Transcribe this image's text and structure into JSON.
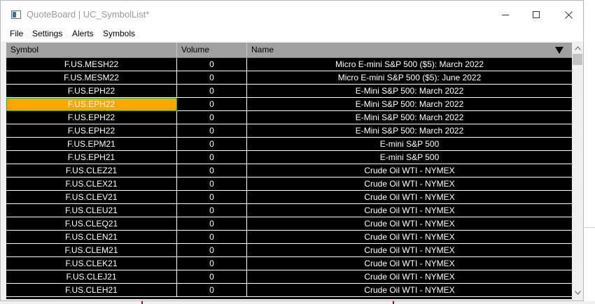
{
  "window": {
    "title": "QuoteBoard | UC_SymbolList*",
    "app_icon": "window-app-icon",
    "controls": [
      "minimize-icon",
      "maximize-icon",
      "close-icon"
    ]
  },
  "menu": {
    "items": [
      {
        "label": "File"
      },
      {
        "label": "Settings"
      },
      {
        "label": "Alerts"
      },
      {
        "label": "Symbols"
      }
    ]
  },
  "grid": {
    "columns": [
      {
        "label": "Symbol"
      },
      {
        "label": "Volume"
      },
      {
        "label": "Name"
      }
    ],
    "sort_icon": "sort-down-triangle-icon",
    "colors": {
      "background": "#000000",
      "text": "#ffffff",
      "header": "#a0a0a0",
      "selected": "#ffa500"
    },
    "selected_row": 3,
    "rows": [
      {
        "symbol": "F.US.MESH22",
        "volume": "0",
        "name": "Micro E-mini S&P 500 ($5): March 2022"
      },
      {
        "symbol": "F.US.MESM22",
        "volume": "0",
        "name": "Micro E-mini S&P 500 ($5): June 2022"
      },
      {
        "symbol": "F.US.EPH22",
        "volume": "0",
        "name": "E-Mini S&P 500: March 2022"
      },
      {
        "symbol": "F.US.EPH22",
        "volume": "0",
        "name": "E-Mini S&P 500: March 2022"
      },
      {
        "symbol": "F.US.EPH22",
        "volume": "0",
        "name": "E-Mini S&P 500: March 2022"
      },
      {
        "symbol": "F.US.EPH22",
        "volume": "0",
        "name": "E-Mini S&P 500: March 2022"
      },
      {
        "symbol": "F.US.EPM21",
        "volume": "0",
        "name": "E-mini S&P 500"
      },
      {
        "symbol": "F.US.EPH21",
        "volume": "0",
        "name": "E-mini S&P 500"
      },
      {
        "symbol": "F.US.CLEZ21",
        "volume": "0",
        "name": "Crude Oil WTI - NYMEX"
      },
      {
        "symbol": "F.US.CLEX21",
        "volume": "0",
        "name": "Crude Oil WTI - NYMEX"
      },
      {
        "symbol": "F.US.CLEV21",
        "volume": "0",
        "name": "Crude Oil WTI - NYMEX"
      },
      {
        "symbol": "F.US.CLEU21",
        "volume": "0",
        "name": "Crude Oil WTI - NYMEX"
      },
      {
        "symbol": "F.US.CLEQ21",
        "volume": "0",
        "name": "Crude Oil WTI - NYMEX"
      },
      {
        "symbol": "F.US.CLEN21",
        "volume": "0",
        "name": "Crude Oil WTI - NYMEX"
      },
      {
        "symbol": "F.US.CLEM21",
        "volume": "0",
        "name": "Crude Oil WTI - NYMEX"
      },
      {
        "symbol": "F.US.CLEK21",
        "volume": "0",
        "name": "Crude Oil WTI - NYMEX"
      },
      {
        "symbol": "F.US.CLEJ21",
        "volume": "0",
        "name": "Crude Oil WTI - NYMEX"
      },
      {
        "symbol": "F.US.CLEH21",
        "volume": "0",
        "name": "Crude Oil WTI - NYMEX"
      }
    ]
  }
}
